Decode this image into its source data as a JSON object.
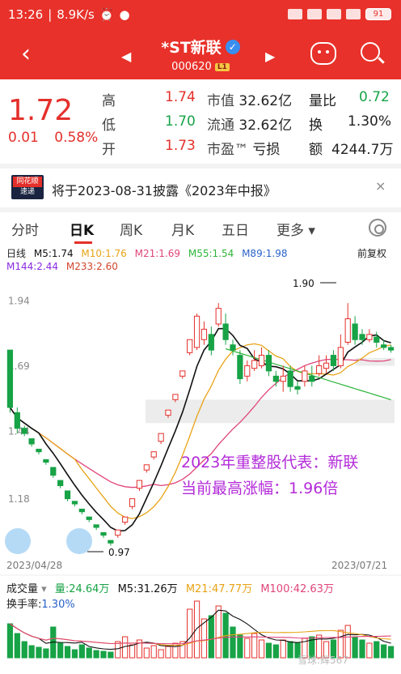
{
  "status_bar": {
    "time": "13:26",
    "speed": "8.9K/s",
    "battery": "91"
  },
  "header": {
    "stock_name": "*ST新联",
    "stock_code": "000620",
    "level_badge": "L1",
    "colors": {
      "background": "#e8312a"
    }
  },
  "quote": {
    "price": "1.72",
    "change": "0.01",
    "change_pct": "0.58%",
    "high_label": "高",
    "high": "1.74",
    "low_label": "低",
    "low": "1.70",
    "open_label": "开",
    "open": "1.73",
    "mcap_label": "市值",
    "mcap": "32.62亿",
    "float_label": "流通",
    "float": "32.62亿",
    "pe_label": "市盈™",
    "pe": "亏损",
    "vol_ratio_label": "量比",
    "vol_ratio": "0.72",
    "turnover_label": "换",
    "turnover": "1.30%",
    "amount_label": "额",
    "amount": "4244.7万"
  },
  "notice": {
    "badge_top": "同花顺",
    "badge_bottom": "速递",
    "text": "将于2023-08-31披露《2023年中报》",
    "close": "×"
  },
  "tabs": [
    "分时",
    "日K",
    "周K",
    "月K",
    "五日",
    "更多 ▾"
  ],
  "active_tab": "日K",
  "kline": {
    "period_label": "日线",
    "adjust_label": "前复权",
    "ma": [
      {
        "label": "M5:1.74",
        "color": "#111111"
      },
      {
        "label": "M10:1.76",
        "color": "#e8a317"
      },
      {
        "label": "M21:1.69",
        "color": "#e0457b"
      },
      {
        "label": "M55:1.54",
        "color": "#2fb53a"
      },
      {
        "label": "M89:1.98",
        "color": "#2a62c9"
      },
      {
        "label": "M144:2.44",
        "color": "#8a2be2"
      },
      {
        "label": "M233:2.60",
        "color": "#d2452b"
      }
    ]
  },
  "chart_data": [
    {
      "type": "candlestick",
      "title": "",
      "date_start": "2023/04/28",
      "date_end": "2023/07/21",
      "y_ticks": [
        "1.94",
        "1.69",
        "1.44",
        "1.18"
      ],
      "ylim": [
        0.95,
        2.0
      ],
      "annotations": {
        "high": "1.90",
        "low": "0.97"
      },
      "overlay_text": [
        "2023年重整股代表：新联",
        "当前最高涨幅：1.96倍"
      ],
      "candles": [
        [
          1.72,
          1.5,
          1.72,
          1.48
        ],
        [
          1.48,
          1.42,
          1.5,
          1.4
        ],
        [
          1.42,
          1.4,
          1.43,
          1.39
        ],
        [
          1.38,
          1.36,
          1.38,
          1.35
        ],
        [
          1.34,
          1.33,
          1.34,
          1.32
        ],
        [
          1.3,
          1.29,
          1.3,
          1.28
        ],
        [
          1.27,
          1.24,
          1.27,
          1.23
        ],
        [
          1.22,
          1.2,
          1.22,
          1.19
        ],
        [
          1.18,
          1.15,
          1.18,
          1.14
        ],
        [
          1.14,
          1.13,
          1.14,
          1.12
        ],
        [
          1.11,
          1.1,
          1.11,
          1.09
        ],
        [
          1.08,
          1.07,
          1.08,
          1.06
        ],
        [
          1.05,
          1.04,
          1.05,
          1.03
        ],
        [
          1.02,
          1.01,
          1.02,
          1.0
        ],
        [
          0.99,
          0.98,
          0.99,
          0.97
        ],
        [
          1.01,
          1.03,
          1.03,
          1.0
        ],
        [
          1.06,
          1.08,
          1.08,
          1.05
        ],
        [
          1.12,
          1.15,
          1.15,
          1.11
        ],
        [
          1.19,
          1.22,
          1.22,
          1.18
        ],
        [
          1.26,
          1.28,
          1.28,
          1.25
        ],
        [
          1.31,
          1.33,
          1.33,
          1.3
        ],
        [
          1.37,
          1.4,
          1.4,
          1.36
        ],
        [
          1.47,
          1.49,
          1.49,
          1.46
        ],
        [
          1.53,
          1.55,
          1.55,
          1.52
        ],
        [
          1.62,
          1.64,
          1.64,
          1.61
        ],
        [
          1.71,
          1.76,
          1.76,
          1.7
        ],
        [
          1.73,
          1.85,
          1.86,
          1.72
        ],
        [
          1.76,
          1.8,
          1.83,
          1.74
        ],
        [
          1.78,
          1.72,
          1.81,
          1.7
        ],
        [
          1.82,
          1.88,
          1.9,
          1.81
        ],
        [
          1.82,
          1.76,
          1.86,
          1.74
        ],
        [
          1.74,
          1.72,
          1.76,
          1.7
        ],
        [
          1.7,
          1.61,
          1.72,
          1.59
        ],
        [
          1.62,
          1.66,
          1.68,
          1.6
        ],
        [
          1.65,
          1.68,
          1.72,
          1.64
        ],
        [
          1.66,
          1.7,
          1.73,
          1.65
        ],
        [
          1.7,
          1.64,
          1.72,
          1.62
        ],
        [
          1.62,
          1.6,
          1.64,
          1.58
        ],
        [
          1.6,
          1.62,
          1.66,
          1.56
        ],
        [
          1.64,
          1.58,
          1.66,
          1.56
        ],
        [
          1.58,
          1.57,
          1.6,
          1.55
        ],
        [
          1.6,
          1.64,
          1.66,
          1.58
        ],
        [
          1.62,
          1.6,
          1.66,
          1.58
        ],
        [
          1.63,
          1.66,
          1.7,
          1.62
        ],
        [
          1.65,
          1.67,
          1.7,
          1.63
        ],
        [
          1.7,
          1.66,
          1.72,
          1.64
        ],
        [
          1.66,
          1.73,
          1.78,
          1.65
        ],
        [
          1.75,
          1.84,
          1.9,
          1.74
        ],
        [
          1.82,
          1.76,
          1.85,
          1.74
        ],
        [
          1.78,
          1.76,
          1.8,
          1.74
        ],
        [
          1.76,
          1.78,
          1.8,
          1.75
        ],
        [
          1.77,
          1.75,
          1.79,
          1.73
        ],
        [
          1.74,
          1.73,
          1.76,
          1.72
        ],
        [
          1.73,
          1.72,
          1.74,
          1.71
        ]
      ]
    },
    {
      "type": "bar",
      "title": "成交量",
      "series": [
        {
          "name": "量:24.64万",
          "color": "#17a346"
        },
        {
          "name": "M5:31.26万",
          "color": "#111111"
        },
        {
          "name": "M21:47.77万",
          "color": "#e8a317"
        },
        {
          "name": "M100:42.63万",
          "color": "#e0457b"
        }
      ],
      "turnover_label": "换手率:",
      "turnover_value": "1.30%",
      "values": [
        42,
        30,
        20,
        15,
        13,
        11,
        38,
        18,
        14,
        10,
        16,
        12,
        9,
        8,
        7,
        20,
        26,
        16,
        22,
        12,
        15,
        10,
        14,
        18,
        20,
        60,
        70,
        48,
        52,
        64,
        55,
        38,
        28,
        24,
        30,
        22,
        18,
        16,
        22,
        20,
        18,
        24,
        26,
        28,
        20,
        22,
        34,
        40,
        26,
        22,
        18,
        20,
        16,
        14
      ]
    }
  ],
  "watermark": "雪球:辉567"
}
